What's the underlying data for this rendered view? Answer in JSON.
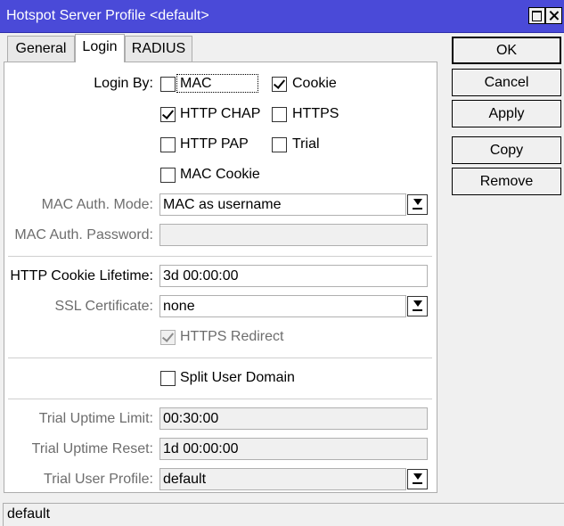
{
  "window": {
    "title": "Hotspot Server Profile <default>"
  },
  "tabs": [
    {
      "label": "General",
      "active": false
    },
    {
      "label": "Login",
      "active": true
    },
    {
      "label": "RADIUS",
      "active": false
    }
  ],
  "login_by": {
    "label": "Login By:",
    "options": [
      {
        "label": "MAC",
        "checked": false
      },
      {
        "label": "Cookie",
        "checked": true
      },
      {
        "label": "HTTP CHAP",
        "checked": true
      },
      {
        "label": "HTTPS",
        "checked": false
      },
      {
        "label": "HTTP PAP",
        "checked": false
      },
      {
        "label": "Trial",
        "checked": false
      },
      {
        "label": "MAC Cookie",
        "checked": false
      }
    ]
  },
  "mac_auth_mode": {
    "label": "MAC Auth. Mode:",
    "value": "MAC as username"
  },
  "mac_auth_password": {
    "label": "MAC Auth. Password:",
    "value": ""
  },
  "http_cookie_lifetime": {
    "label": "HTTP Cookie Lifetime:",
    "value": "3d 00:00:00"
  },
  "ssl_certificate": {
    "label": "SSL Certificate:",
    "value": "none"
  },
  "https_redirect": {
    "label": "HTTPS Redirect",
    "checked": true,
    "disabled": true
  },
  "split_user_domain": {
    "label": "Split User Domain",
    "checked": false
  },
  "trial_uptime_limit": {
    "label": "Trial Uptime Limit:",
    "value": "00:30:00"
  },
  "trial_uptime_reset": {
    "label": "Trial Uptime Reset:",
    "value": "1d 00:00:00"
  },
  "trial_user_profile": {
    "label": "Trial User Profile:",
    "value": "default"
  },
  "actions": {
    "ok": "OK",
    "cancel": "Cancel",
    "apply": "Apply",
    "copy": "Copy",
    "remove": "Remove"
  },
  "status_bar": {
    "text": "default"
  },
  "colors": {
    "titlebar": "#4a4ad8",
    "window_bg": "#f0f0f0",
    "disabled_text": "#6d6d6d"
  }
}
